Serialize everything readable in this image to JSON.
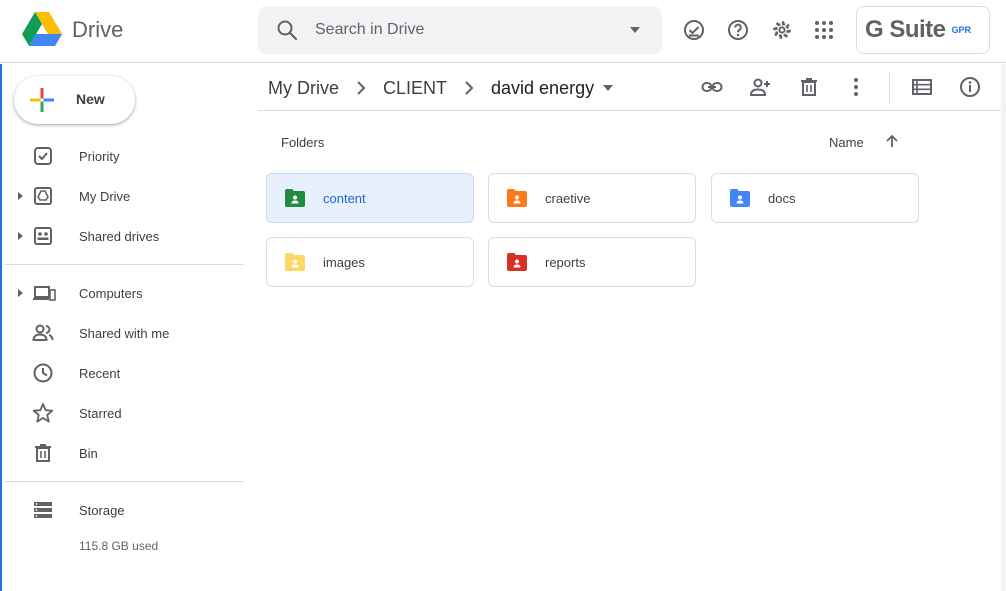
{
  "app": {
    "name": "Drive"
  },
  "search": {
    "placeholder": "Search in Drive"
  },
  "gsuite": {
    "label": "G Suite",
    "partner": "GPR"
  },
  "new_button": {
    "label": "New"
  },
  "sidebar": {
    "items": [
      {
        "label": "Priority",
        "icon": "priority-icon",
        "expandable": false
      },
      {
        "label": "My Drive",
        "icon": "my-drive-icon",
        "expandable": true
      },
      {
        "label": "Shared drives",
        "icon": "shared-drives-icon",
        "expandable": true
      },
      {
        "label": "Computers",
        "icon": "computers-icon",
        "expandable": true
      },
      {
        "label": "Shared with me",
        "icon": "shared-with-me-icon",
        "expandable": false
      },
      {
        "label": "Recent",
        "icon": "clock-icon",
        "expandable": false
      },
      {
        "label": "Starred",
        "icon": "star-icon",
        "expandable": false
      },
      {
        "label": "Bin",
        "icon": "trash-icon",
        "expandable": false
      },
      {
        "label": "Storage",
        "icon": "storage-icon",
        "expandable": false
      }
    ],
    "storage_used": "115.8 GB used"
  },
  "breadcrumb": {
    "items": [
      "My Drive",
      "CLIENT"
    ],
    "current": "david energy"
  },
  "section": {
    "title": "Folders",
    "sort_label": "Name"
  },
  "folders": [
    {
      "name": "content",
      "color": "#1e8e3e",
      "selected": true
    },
    {
      "name": "craetive",
      "color": "#fa7b17",
      "selected": false
    },
    {
      "name": "docs",
      "color": "#4285f4",
      "selected": false
    },
    {
      "name": "images",
      "color": "#fdd663",
      "selected": false
    },
    {
      "name": "reports",
      "color": "#d93025",
      "selected": false
    }
  ],
  "colors": {
    "accent": "#1a73e8",
    "selected_bg": "#e8f0fe"
  }
}
